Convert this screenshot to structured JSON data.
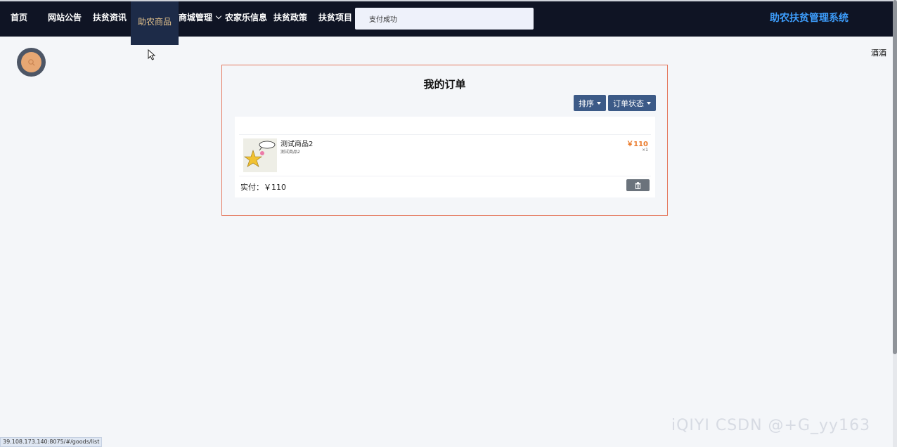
{
  "nav": {
    "items": [
      {
        "label": "首页"
      },
      {
        "label": "网站公告"
      },
      {
        "label": "扶贫资讯"
      },
      {
        "label": "助农商品",
        "active": true
      },
      {
        "label": "商城管理",
        "has_dropdown": true
      },
      {
        "label": "农家乐信息"
      },
      {
        "label": "扶贫政策"
      },
      {
        "label": "扶贫项目"
      }
    ],
    "search_value": "支付成功",
    "system_title": "助农扶贫管理系统"
  },
  "user": {
    "avatar_icon": "search-icon",
    "username": "酒酒"
  },
  "orders": {
    "title": "我的订单",
    "sort_label": "排序",
    "status_label": "订单状态",
    "items": [
      {
        "name": "测试商品2",
        "subtitle": "测试商品2",
        "price": "￥110",
        "quantity": "×1",
        "paid": "实付：￥110",
        "delete_icon": "trash-icon"
      }
    ]
  },
  "status_url": "39.108.173.140:8075/#/goods/list",
  "watermark": "iQIYI CSDN @+G_yy163",
  "colors": {
    "topbar": "#0f1424",
    "active_nav": "#1d2b48",
    "active_nav_text": "#e4c28b",
    "system_title": "#3d9dfc",
    "button": "#3c5a87",
    "price": "#ea7b2c",
    "panel_border": "#e4795f"
  }
}
